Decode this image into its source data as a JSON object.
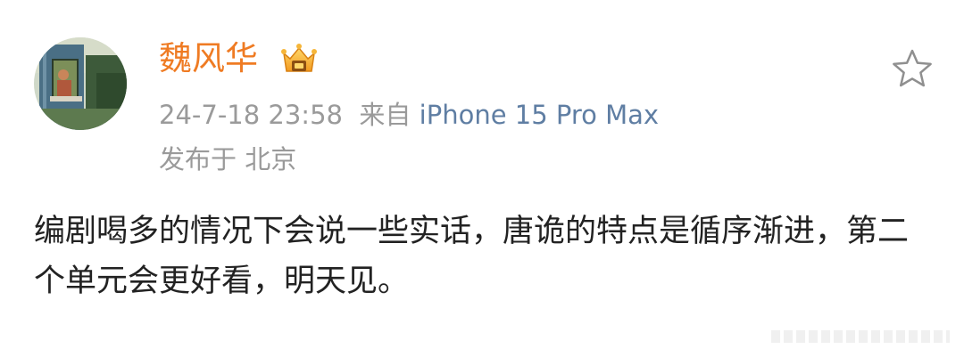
{
  "post": {
    "user": {
      "name": "魏风华"
    },
    "meta": {
      "time": "24-7-18 23:58",
      "source_prefix": "来自",
      "source": "iPhone 15 Pro Max"
    },
    "location": "发布于 北京",
    "content": "编剧喝多的情况下会说一些实话，唐诡的特点是循序渐进，第二个单元会更好看，明天见。"
  },
  "icons": {
    "badge": "vip-crown-badge-icon",
    "favorite": "star-outline-icon"
  },
  "colors": {
    "username": "#ef7b23",
    "meta": "#9a9a9a",
    "source_link": "#5f7ea3",
    "text": "#222222"
  }
}
